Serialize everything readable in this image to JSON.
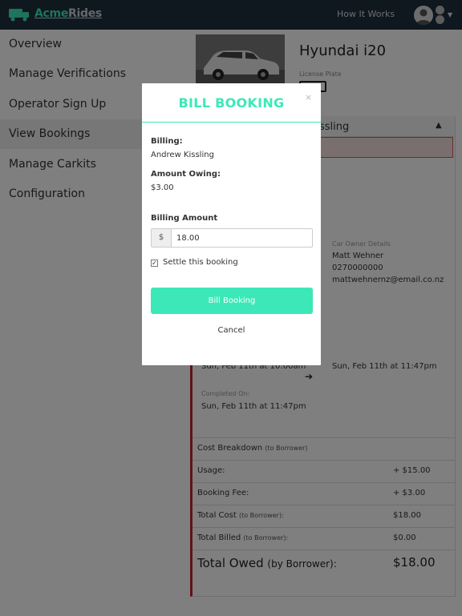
{
  "header": {
    "brand_prefix": "Acme",
    "brand_suffix": "Rides",
    "how_it_works": "How It Works"
  },
  "sidebar": {
    "items": [
      {
        "label": "Overview"
      },
      {
        "label": "Manage Verifications"
      },
      {
        "label": "Operator Sign Up"
      },
      {
        "label": "View Bookings"
      },
      {
        "label": "Manage Carkits"
      },
      {
        "label": "Configuration"
      }
    ]
  },
  "vehicle": {
    "name": "Hyundai i20",
    "plate_label": "License Plate"
  },
  "booking": {
    "header_text": "ssling",
    "owner_label": "Car Owner Details",
    "owner_name": "Matt Wehner",
    "owner_phone": "0270000000",
    "owner_email": "mattwehnernz@email.co.nz",
    "start_date": "Sun, Feb 11th at 10:00am",
    "end_date": "Sun, Feb 11th at 11:47pm",
    "completed_label": "Completed On:",
    "completed_date": "Sun, Feb 11th at 11:47pm"
  },
  "costs": {
    "breakdown_label": "Cost Breakdown",
    "breakdown_note": "(to Borrower)",
    "usage_label": "Usage:",
    "usage_value": "+ $15.00",
    "fee_label": "Booking Fee:",
    "fee_value": "+ $3.00",
    "total_cost_label": "Total Cost",
    "total_cost_note": "(to Borrower):",
    "total_cost_value": "$18.00",
    "total_billed_label": "Total Billed",
    "total_billed_note": "(to Borrower):",
    "total_billed_value": "$0.00",
    "owed_label": "Total Owed",
    "owed_note": "(by Borrower):",
    "owed_value": "$18.00"
  },
  "modal": {
    "title": "BILL BOOKING",
    "close": "×",
    "billing_label": "Billing:",
    "billing_name": "Andrew Kissling",
    "owing_label": "Amount Owing:",
    "owing_value": "$3.00",
    "amount_label": "Billing Amount",
    "currency": "$",
    "amount_value": "18.00",
    "settle_label": "Settle this booking",
    "settle_checked": true,
    "bill_button": "Bill Booking",
    "cancel": "Cancel"
  },
  "colors": {
    "accent": "#3de8b8",
    "topbar": "#1e2f3f",
    "alert_red": "#c0262d"
  }
}
